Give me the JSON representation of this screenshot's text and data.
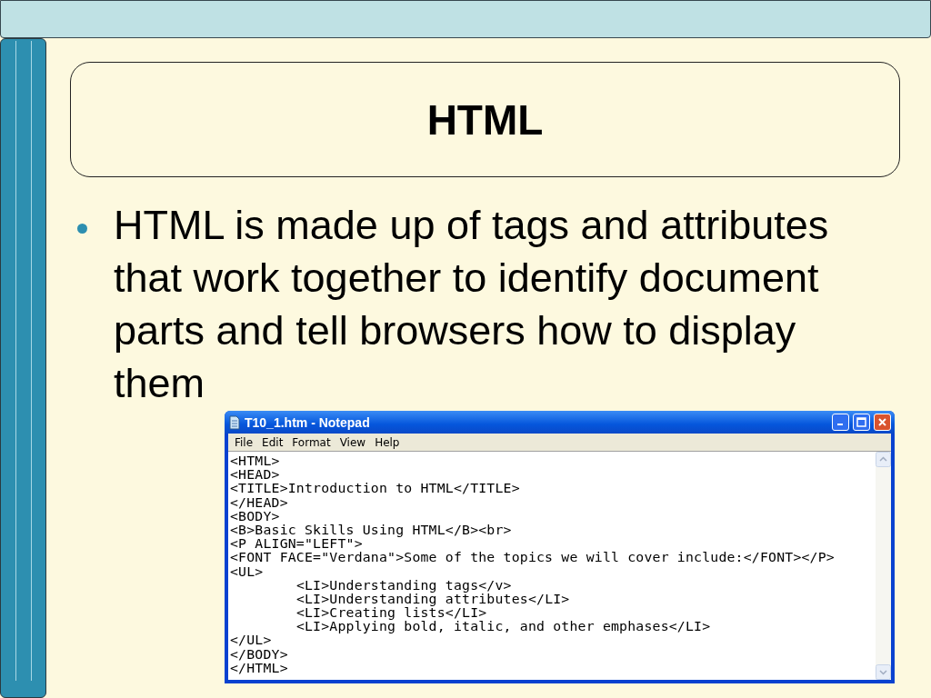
{
  "slide": {
    "title": "HTML",
    "bullets": [
      "HTML is made up of tags and attributes that work together to identify document parts and tell browsers how to display them"
    ]
  },
  "notepad": {
    "title": "T10_1.htm - Notepad",
    "menu": [
      "File",
      "Edit",
      "Format",
      "View",
      "Help"
    ],
    "lines": [
      "<HTML>",
      "<HEAD>",
      "<TITLE>Introduction to HTML</TITLE>",
      "</HEAD>",
      "<BODY>",
      "<B>Basic Skills Using HTML</B><br>",
      "<P ALIGN=\"LEFT\">",
      "<FONT FACE=\"Verdana\">Some of the topics we will cover include:</FONT></P>",
      "<UL>",
      "\t<LI>Understanding tags</v>",
      "\t<LI>Understanding attributes</LI>",
      "\t<LI>Creating lists</LI>",
      "\t<LI>Applying bold, italic, and other emphases</LI>",
      "</UL>",
      "</BODY>",
      "</HTML>"
    ]
  }
}
